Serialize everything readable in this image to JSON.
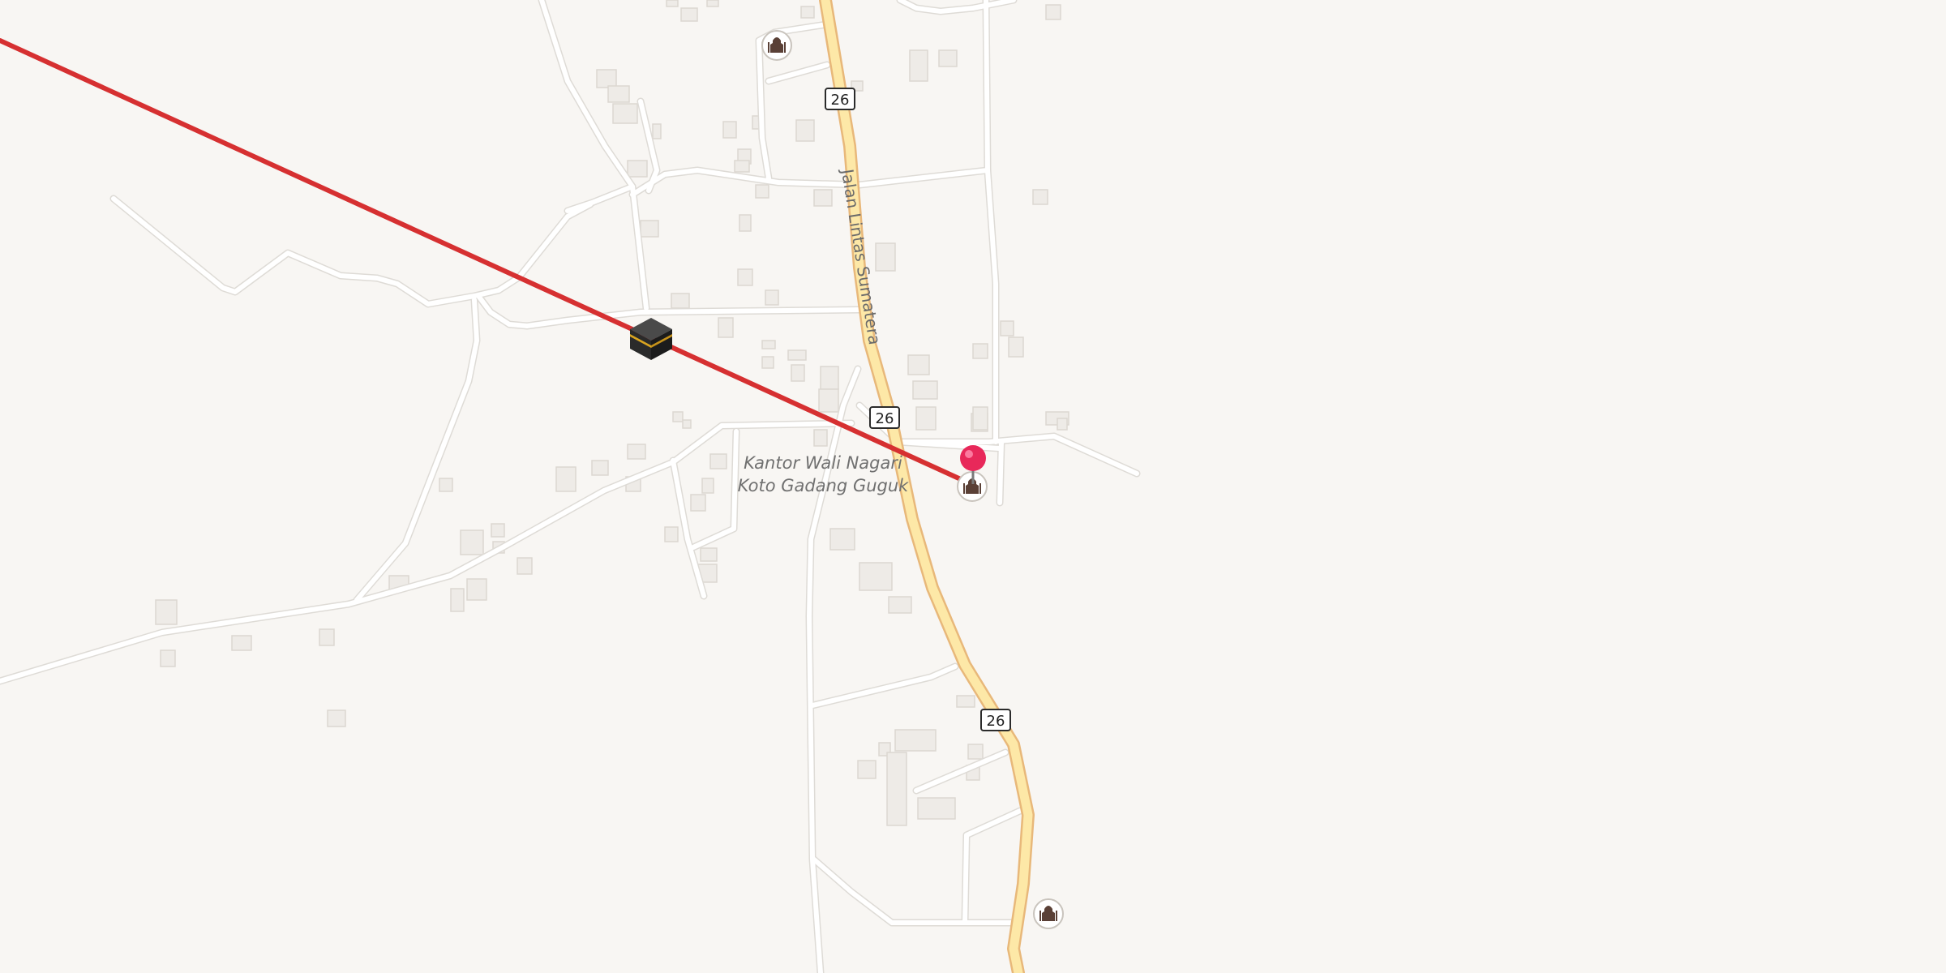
{
  "map": {
    "background": "#f8f6f3",
    "road_color": "#ffffff",
    "road_casing": "#dedbd6",
    "highway_fill": "#fde8a7",
    "highway_casing": "#e8b87a",
    "building_fill": "#eeebe7",
    "building_edge": "#dcd7d1",
    "qibla_line_color": "#d63031"
  },
  "highway": {
    "name": "Jalan Lintas Sumatera",
    "route_shields": [
      "26",
      "26",
      "26"
    ]
  },
  "place": {
    "name_line1": "Kantor Wali Nagari",
    "name_line2": "Koto Gadang Guguk"
  },
  "markers": {
    "location_pin": {
      "icon": "red-location-pin-icon",
      "color": "#e8285a"
    },
    "kaaba": {
      "icon": "kaaba-icon"
    },
    "mosques": [
      {
        "icon": "mosque-icon"
      },
      {
        "icon": "mosque-icon"
      },
      {
        "icon": "mosque-icon"
      }
    ]
  }
}
